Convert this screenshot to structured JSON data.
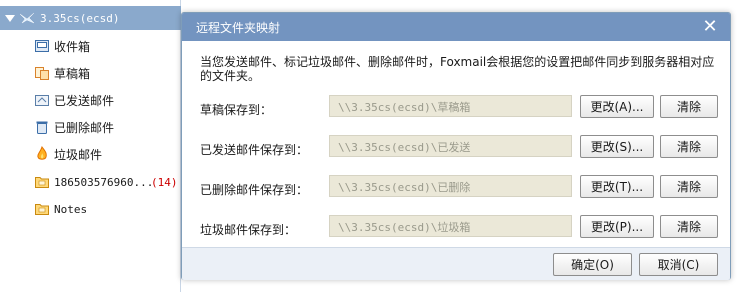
{
  "sidebar": {
    "account": "3.35cs(ecsd)",
    "folders": [
      {
        "label": "收件箱",
        "icon": "inbox-icon"
      },
      {
        "label": "草稿箱",
        "icon": "drafts-icon"
      },
      {
        "label": "已发送邮件",
        "icon": "sent-icon"
      },
      {
        "label": "已删除邮件",
        "icon": "trash-icon"
      },
      {
        "label": "垃圾邮件",
        "icon": "junk-icon"
      },
      {
        "label": "186503576960...",
        "count": "(14)",
        "icon": "folder-icon"
      },
      {
        "label": "Notes",
        "icon": "folder-icon"
      }
    ]
  },
  "dialog": {
    "title": "远程文件夹映射",
    "close": "✕",
    "description": "当您发送邮件、标记垃圾邮件、删除邮件时，Foxmail会根据您的设置把邮件同步到服务器相对应的文件夹。",
    "rows": [
      {
        "label": "草稿保存到：",
        "path": "\\\\3.35cs(ecsd)\\草稿箱",
        "change": "更改(A)...",
        "clear": "清除"
      },
      {
        "label": "已发送邮件保存到：",
        "path": "\\\\3.35cs(ecsd)\\已发送",
        "change": "更改(S)...",
        "clear": "清除"
      },
      {
        "label": "已删除邮件保存到：",
        "path": "\\\\3.35cs(ecsd)\\已删除",
        "change": "更改(T)...",
        "clear": "清除"
      },
      {
        "label": "垃圾邮件保存到：",
        "path": "\\\\3.35cs(ecsd)\\垃圾箱",
        "change": "更改(P)...",
        "clear": "清除"
      }
    ],
    "ok": "确定(O)",
    "cancel": "取消(C)"
  },
  "colors": {
    "titlebar": "#7394c0",
    "account_row": "#8aa9cc",
    "disabled_field": "#ebe8d8",
    "count": "#cc0000"
  }
}
